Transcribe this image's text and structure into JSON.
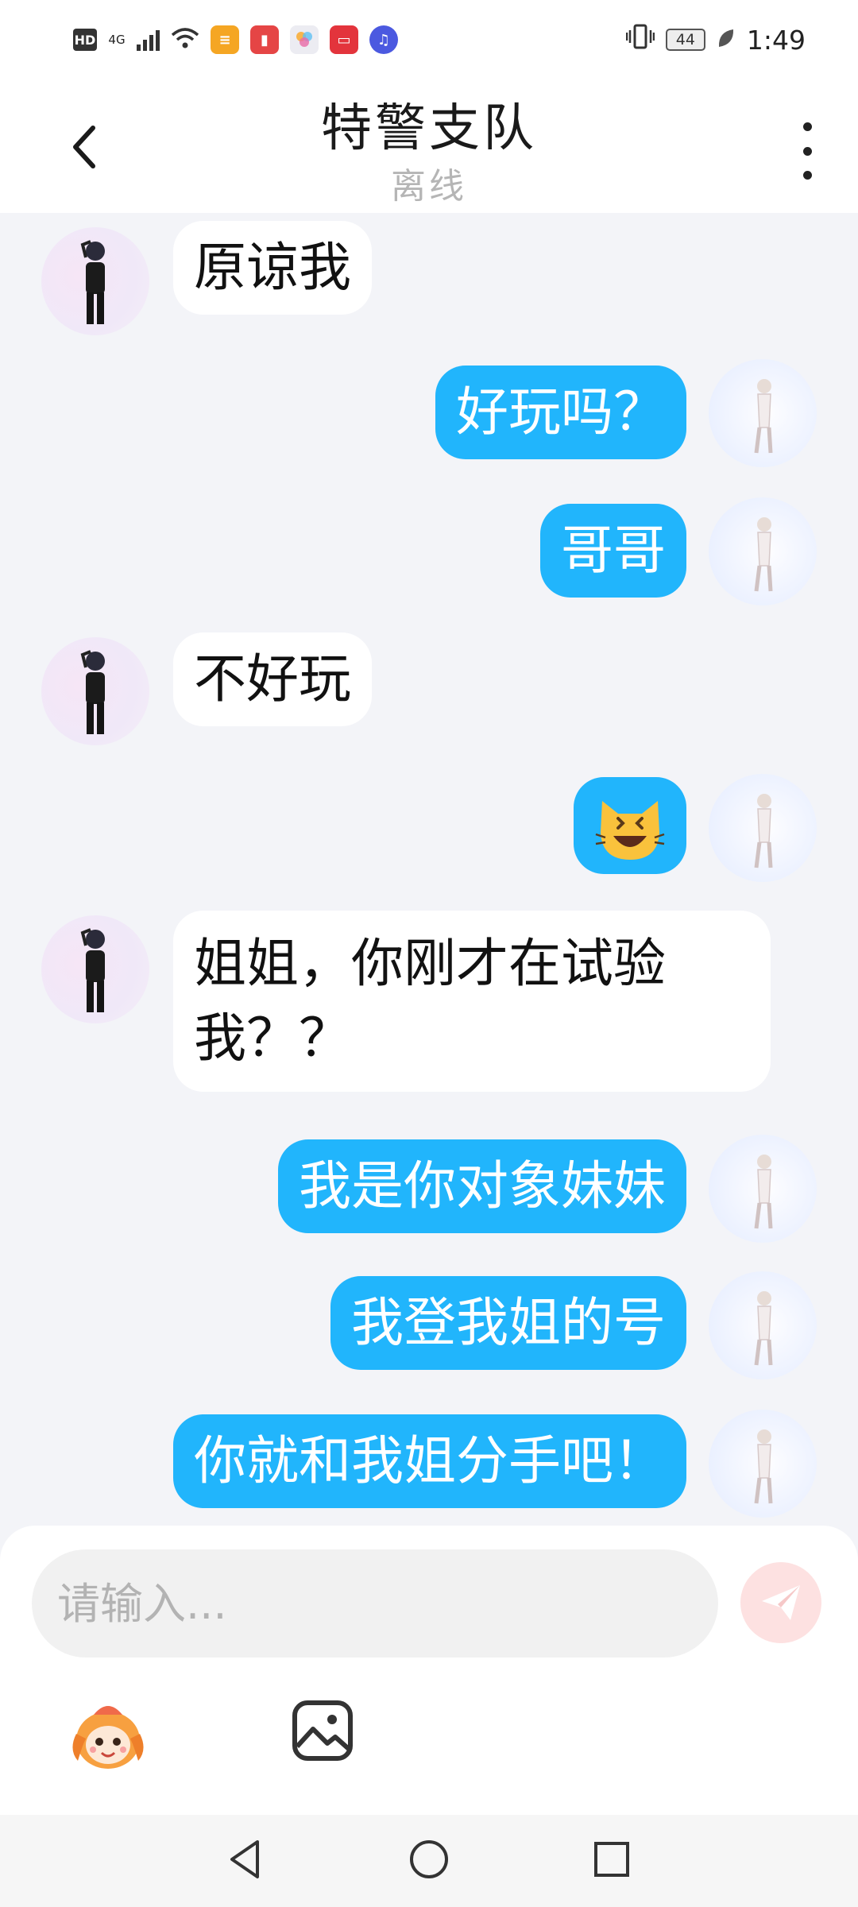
{
  "status_bar": {
    "time": "1:49",
    "battery": "44",
    "network": "4G",
    "hd_label": "HD",
    "app_icons": [
      "notes-app-icon",
      "books-app-icon",
      "gallery-app-icon",
      "huawei-app-icon",
      "music-app-icon"
    ]
  },
  "header": {
    "title": "特警支队",
    "subtitle": "离线"
  },
  "messages": [
    {
      "side": "in",
      "text": "原谅我"
    },
    {
      "side": "out",
      "text": "好玩吗？"
    },
    {
      "side": "out",
      "text": "哥哥"
    },
    {
      "side": "in",
      "text": "不好玩"
    },
    {
      "side": "out",
      "text": "😆"
    },
    {
      "side": "in",
      "text": "姐姐，你刚才在试验我？？"
    },
    {
      "side": "out",
      "text": "我是你对象妹妹"
    },
    {
      "side": "out",
      "text": "我登我姐的号"
    },
    {
      "side": "out",
      "text": "你就和我姐分手吧！"
    }
  ],
  "input": {
    "placeholder": "请输入..."
  },
  "colors": {
    "outgoing_bubble": "#21b5fc",
    "incoming_bubble": "#ffffff",
    "chat_background": "#f3f4f8",
    "send_button": "#fde1e1"
  },
  "toolbar_icons": [
    "emoji-icon",
    "image-icon"
  ],
  "nav_icons": [
    "nav-back-icon",
    "nav-home-icon",
    "nav-recent-icon"
  ]
}
